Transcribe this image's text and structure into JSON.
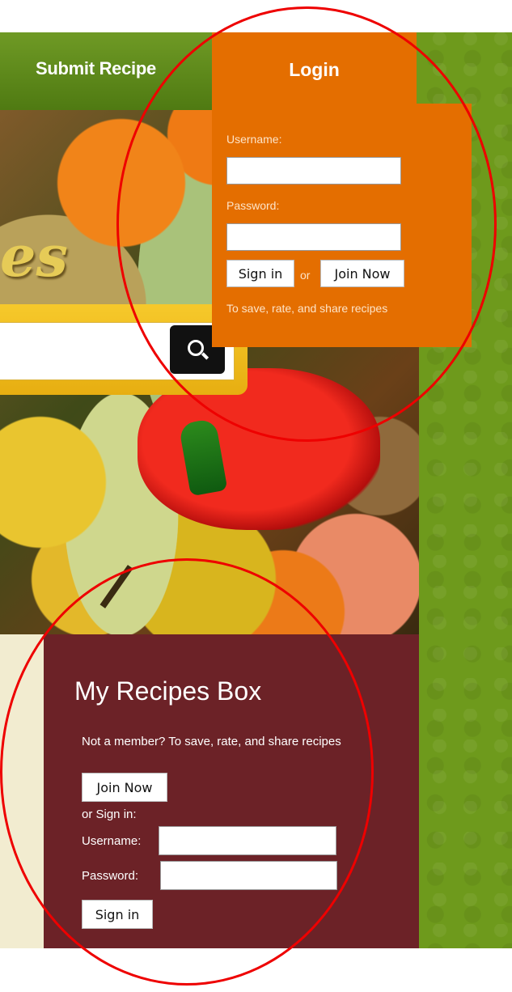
{
  "nav": {
    "submit_recipe": "Submit Recipe"
  },
  "login_tab": {
    "label": "Login"
  },
  "login_panel": {
    "username_label": "Username:",
    "password_label": "Password:",
    "sign_in": "Sign in",
    "or": "or",
    "join_now": "Join Now",
    "note": "To save, rate, and share recipes"
  },
  "hero": {
    "logo_fragment": "es"
  },
  "recipes_box": {
    "title": "My Recipes Box",
    "intro": "Not a member? To save, rate, and share recipes",
    "join_now": "Join Now",
    "or_sign_in": "or Sign in:",
    "username_label": "Username:",
    "password_label": "Password:",
    "sign_in": "Sign in"
  },
  "colors": {
    "login_orange": "#e46e00",
    "recipes_box_maroon": "#6c2227",
    "nav_green": "#5a8518",
    "search_gold": "#f0bd1f",
    "annotation_red": "#ee0000"
  },
  "icons": {
    "search": "search-icon"
  }
}
